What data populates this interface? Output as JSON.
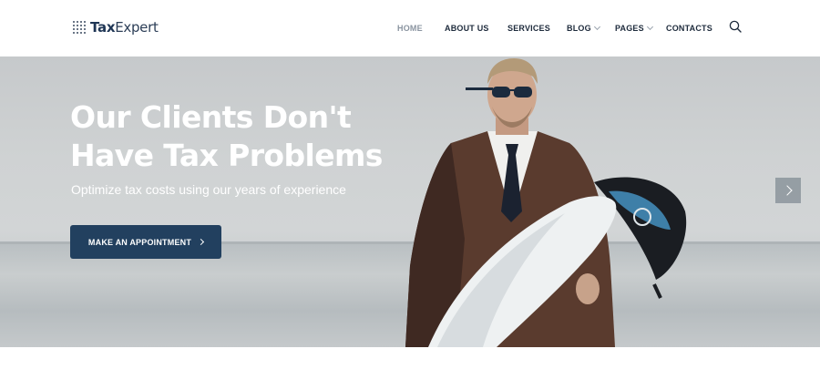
{
  "header": {
    "logo": {
      "bold": "Tax",
      "light": "Expert"
    },
    "nav": [
      {
        "label": "HOME",
        "active": true,
        "dropdown": false
      },
      {
        "label": "ABOUT US",
        "active": false,
        "dropdown": false
      },
      {
        "label": "SERVICES",
        "active": false,
        "dropdown": false
      },
      {
        "label": "BLOG",
        "active": false,
        "dropdown": true
      },
      {
        "label": "PAGES",
        "active": false,
        "dropdown": true
      },
      {
        "label": "CONTACTS",
        "active": false,
        "dropdown": false
      }
    ],
    "search_icon": "search-icon"
  },
  "hero": {
    "title_line1": "Our Clients Don't",
    "title_line2": "Have Tax Problems",
    "subtitle": "Optimize tax costs using our years of experience",
    "cta_label": "MAKE AN APPOINTMENT",
    "next_icon": "chevron-right-icon"
  },
  "colors": {
    "brand": "#22405f",
    "nav_text": "#1e2b3c",
    "nav_active": "#8a94a0"
  }
}
